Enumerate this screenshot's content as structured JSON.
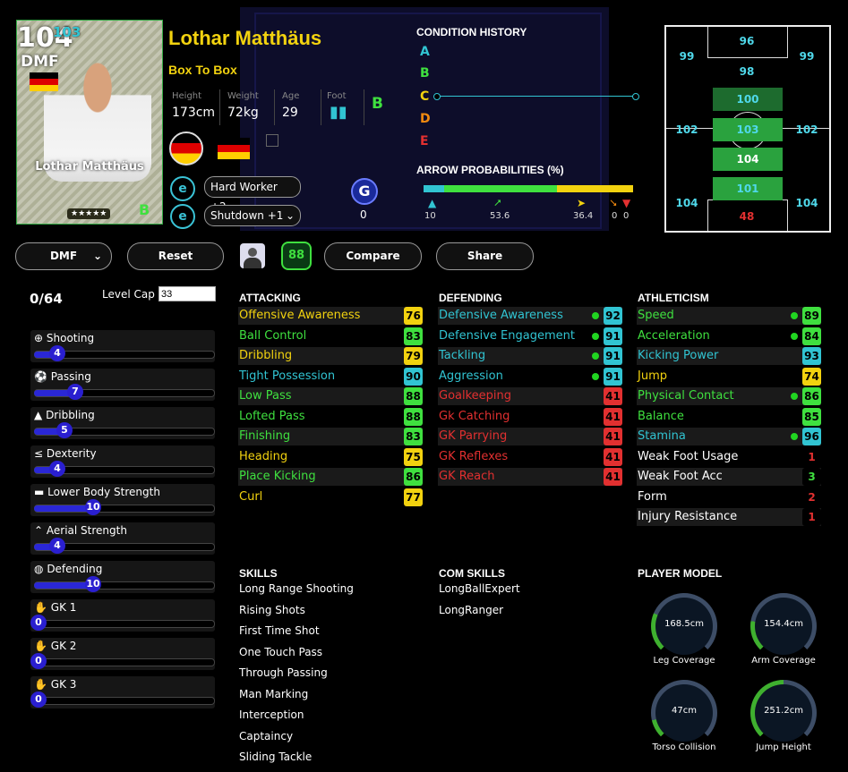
{
  "card": {
    "ovr": "104",
    "ovr_boost": "103",
    "position": "DMF",
    "name": "Lothar Matthäus",
    "stars": "★★★★★",
    "rank": "B"
  },
  "player": {
    "name": "Lothar Matthäus",
    "style": "Box To Box",
    "height_label": "Height",
    "height": "173cm",
    "weight_label": "Weight",
    "weight": "72kg",
    "age_label": "Age",
    "age": "29",
    "foot_label": "Foot",
    "grade": "B"
  },
  "skill_selects": [
    "Hard Worker +2",
    "Shutdown +1"
  ],
  "g_count": "0",
  "condition": {
    "title": "CONDITION HISTORY",
    "grades": [
      "A",
      "B",
      "C",
      "D",
      "E"
    ]
  },
  "arrows": {
    "title": "ARROW PROBABILITIES (%)",
    "values": [
      "10",
      "53.6",
      "36.4",
      "0",
      "0"
    ]
  },
  "pitch": {
    "gk_top": "96",
    "cf": "98",
    "lwf": "99",
    "rwf": "99",
    "amf": "100",
    "lmf": "102",
    "cmf": "103",
    "rmf": "102",
    "dmf": "104",
    "cb": "101",
    "lb": "104",
    "rb": "104",
    "gk": "48"
  },
  "buttons": {
    "position": "DMF",
    "reset": "Reset",
    "compare": "Compare",
    "share": "Share",
    "badge": "88"
  },
  "progression": {
    "points": "0/64",
    "level_cap_label": "Level Cap",
    "level_cap": "33",
    "items": [
      {
        "label": "Shooting",
        "value": "4",
        "pct": 0.13
      },
      {
        "label": "Passing",
        "value": "7",
        "pct": 0.23
      },
      {
        "label": "Dribbling",
        "value": "5",
        "pct": 0.17
      },
      {
        "label": "Dexterity",
        "value": "4",
        "pct": 0.13
      },
      {
        "label": "Lower Body Strength",
        "value": "10",
        "pct": 0.33
      },
      {
        "label": "Aerial Strength",
        "value": "4",
        "pct": 0.13
      },
      {
        "label": "Defending",
        "value": "10",
        "pct": 0.33
      },
      {
        "label": "GK 1",
        "value": "0",
        "pct": 0
      },
      {
        "label": "GK 2",
        "value": "0",
        "pct": 0
      },
      {
        "label": "GK 3",
        "value": "0",
        "pct": 0
      }
    ]
  },
  "attacking": {
    "title": "ATTACKING",
    "rows": [
      {
        "name": "Offensive Awareness",
        "value": "76",
        "color": "#f2d20f",
        "box": "#f2d20f"
      },
      {
        "name": "Ball Control",
        "value": "83",
        "color": "#3fe03f",
        "box": "#3fe03f"
      },
      {
        "name": "Dribbling",
        "value": "79",
        "color": "#f2d20f",
        "box": "#f2d20f"
      },
      {
        "name": "Tight Possession",
        "value": "90",
        "color": "#31c4d2",
        "box": "#31c4d2"
      },
      {
        "name": "Low Pass",
        "value": "88",
        "color": "#3fe03f",
        "box": "#3fe03f"
      },
      {
        "name": "Lofted Pass",
        "value": "88",
        "color": "#3fe03f",
        "box": "#3fe03f"
      },
      {
        "name": "Finishing",
        "value": "83",
        "color": "#3fe03f",
        "box": "#3fe03f"
      },
      {
        "name": "Heading",
        "value": "75",
        "color": "#f2d20f",
        "box": "#f2d20f"
      },
      {
        "name": "Place Kicking",
        "value": "86",
        "color": "#3fe03f",
        "box": "#3fe03f"
      },
      {
        "name": "Curl",
        "value": "77",
        "color": "#f2d20f",
        "box": "#f2d20f"
      }
    ]
  },
  "defending": {
    "title": "DEFENDING",
    "rows": [
      {
        "name": "Defensive Awareness",
        "value": "92",
        "color": "#31c4d2",
        "box": "#31c4d2",
        "dot": true
      },
      {
        "name": "Defensive Engagement",
        "value": "91",
        "color": "#31c4d2",
        "box": "#31c4d2",
        "dot": true
      },
      {
        "name": "Tackling",
        "value": "91",
        "color": "#31c4d2",
        "box": "#31c4d2",
        "dot": true
      },
      {
        "name": "Aggression",
        "value": "91",
        "color": "#31c4d2",
        "box": "#31c4d2",
        "dot": true
      },
      {
        "name": "Goalkeeping",
        "value": "41",
        "color": "#e23030",
        "box": "#e23030"
      },
      {
        "name": "Gk Catching",
        "value": "41",
        "color": "#e23030",
        "box": "#e23030"
      },
      {
        "name": "GK Parrying",
        "value": "41",
        "color": "#e23030",
        "box": "#e23030"
      },
      {
        "name": "GK Reflexes",
        "value": "41",
        "color": "#e23030",
        "box": "#e23030"
      },
      {
        "name": "GK Reach",
        "value": "41",
        "color": "#e23030",
        "box": "#e23030"
      }
    ]
  },
  "athleticism": {
    "title": "ATHLETICISM",
    "rows": [
      {
        "name": "Speed",
        "value": "89",
        "color": "#3fe03f",
        "box": "#3fe03f",
        "dot": true
      },
      {
        "name": "Acceleration",
        "value": "84",
        "color": "#3fe03f",
        "box": "#3fe03f",
        "dot": true
      },
      {
        "name": "Kicking Power",
        "value": "93",
        "color": "#31c4d2",
        "box": "#31c4d2"
      },
      {
        "name": "Jump",
        "value": "74",
        "color": "#f2d20f",
        "box": "#f2d20f"
      },
      {
        "name": "Physical Contact",
        "value": "86",
        "color": "#3fe03f",
        "box": "#3fe03f",
        "dot": true
      },
      {
        "name": "Balance",
        "value": "85",
        "color": "#3fe03f",
        "box": "#3fe03f"
      },
      {
        "name": "Stamina",
        "value": "96",
        "color": "#31c4d2",
        "box": "#31c4d2",
        "dot": true
      },
      {
        "name": "Weak Foot Usage",
        "value": "1",
        "color": "#ffffff",
        "box": "#000",
        "vcolor": "#e23030"
      },
      {
        "name": "Weak Foot Acc",
        "value": "3",
        "color": "#ffffff",
        "box": "#000",
        "vcolor": "#3fe03f"
      },
      {
        "name": "Form",
        "value": "2",
        "color": "#ffffff",
        "box": "#000",
        "vcolor": "#e23030"
      },
      {
        "name": "Injury Resistance",
        "value": "1",
        "color": "#ffffff",
        "box": "#000",
        "vcolor": "#e23030"
      }
    ]
  },
  "skills": {
    "title": "SKILLS",
    "items": [
      "Long Range Shooting",
      "Rising Shots",
      "First Time Shot",
      "One Touch Pass",
      "Through Passing",
      "Man Marking",
      "Interception",
      "Captaincy",
      "Sliding Tackle"
    ]
  },
  "com_skills": {
    "title": "COM SKILLS",
    "items": [
      "LongBallExpert",
      "LongRanger"
    ]
  },
  "player_model": {
    "title": "PLAYER MODEL",
    "gauges": [
      {
        "value": "168.5cm",
        "label": "Leg Coverage",
        "fill": 0.25
      },
      {
        "value": "154.4cm",
        "label": "Arm Coverage",
        "fill": 0.2
      },
      {
        "value": "47cm",
        "label": "Torso Collision",
        "fill": 0.12
      },
      {
        "value": "251.2cm",
        "label": "Jump Height",
        "fill": 0.5
      }
    ]
  }
}
